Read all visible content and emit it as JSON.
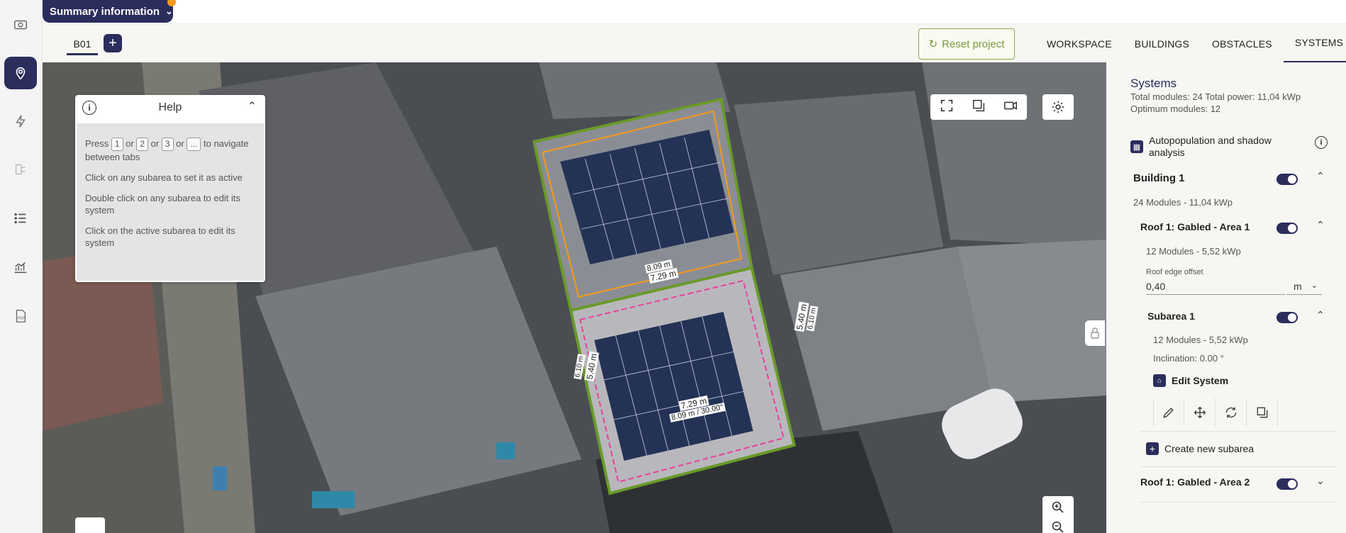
{
  "header": {
    "summary_label": "Summary information",
    "building_tab": "B01",
    "add_tab": "+",
    "reset_label": "Reset project",
    "tabs": [
      {
        "label": "WORKSPACE",
        "active": false
      },
      {
        "label": "BUILDINGS",
        "active": false
      },
      {
        "label": "OBSTACLES",
        "active": false
      },
      {
        "label": "SYSTEMS",
        "active": true
      }
    ]
  },
  "sidebar": {
    "items": [
      {
        "icon": "money-icon",
        "active": false
      },
      {
        "icon": "location-pin-icon",
        "active": true
      },
      {
        "icon": "lightning-icon",
        "active": false
      },
      {
        "icon": "wiring-icon",
        "active": false
      },
      {
        "icon": "list-icon",
        "active": false
      },
      {
        "icon": "chart-icon",
        "active": false
      },
      {
        "icon": "pdf-icon",
        "active": false
      }
    ]
  },
  "help": {
    "title": "Help",
    "keys": [
      "1",
      "2",
      "3",
      "..."
    ],
    "or": "or",
    "to": "to",
    "press": "Press",
    "line1_tail": "navigate between tabs",
    "line2": "Click on any subarea to set it as active",
    "line3": "Double click on any subarea to edit its system",
    "line4": "Click on the active subarea to edit its system"
  },
  "map_labels": {
    "top_edge_a": "8.09 m",
    "top_edge_b": "7.29 m",
    "right_edge_a": "5.40 m",
    "right_edge_b": "6.10 m",
    "left_edge_a": "6.10 m",
    "left_edge_b": "5.40 m",
    "bottom_edge_a": "7.29 m",
    "bottom_edge_b": "8.09 m / 30.00°"
  },
  "systems": {
    "title": "Systems",
    "summary_line": "Total modules: 24 Total power: 11,04 kWp",
    "optimum_line": "Optimum modules: 12",
    "autopop_label": "Autopopulation and shadow analysis",
    "building": {
      "name": "Building 1",
      "summary": "24 Modules - 11,04 kWp"
    },
    "roof1": {
      "name": "Roof 1: Gabled - Area 1",
      "summary": "12 Modules - 5,52 kWp"
    },
    "offset": {
      "label": "Roof edge offset",
      "value": "0,40",
      "unit": "m"
    },
    "subarea": {
      "name": "Subarea 1",
      "summary": "12 Modules - 5,52 kWp",
      "inclination": "Inclination: 0.00 °"
    },
    "edit_system": "Edit System",
    "create_subarea": "Create new subarea",
    "roof2": {
      "name": "Roof 1: Gabled - Area 2"
    }
  },
  "colors": {
    "brand": "#2b2d5c",
    "accent_green": "#7a9a3a",
    "roof_outline": "#6a9a2a",
    "offset_orange": "#f39a1c",
    "subarea_pink": "#e8419a",
    "notification": "#f39a1c"
  }
}
